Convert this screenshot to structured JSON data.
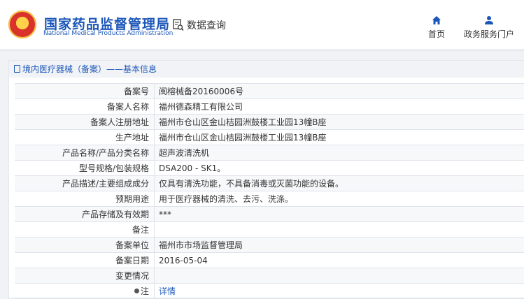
{
  "header": {
    "logo_cn": "国家药品监督管理局",
    "logo_en": "National Medical Products Administration",
    "query_label": "数据查询",
    "nav": [
      {
        "label": "首页",
        "icon": "home-icon"
      },
      {
        "label": "政务服务门户",
        "icon": "user-icon"
      }
    ],
    "brand_color": "#1b56b8"
  },
  "card": {
    "title": "境内医疗器械（备案）——基本信息"
  },
  "rows": [
    {
      "label": "备案号",
      "value": "闽榕械备20160006号"
    },
    {
      "label": "备案人名称",
      "value": "福州德森精工有限公司"
    },
    {
      "label": "备案人注册地址",
      "value": "福州市仓山区金山桔园洲鼓楼工业园13幢B座"
    },
    {
      "label": "生产地址",
      "value": "福州市仓山区金山桔园洲鼓楼工业园13幢B座"
    },
    {
      "label": "产品名称/产品分类名称",
      "value": "超声波清洗机"
    },
    {
      "label": "型号规格/包装规格",
      "value": "DSA200 - SK1。"
    },
    {
      "label": "产品描述/主要组成成分",
      "value": "仅具有清洗功能，不具备消毒或灭菌功能的设备。"
    },
    {
      "label": "预期用途",
      "value": "用于医疗器械的清洗、去污、洗涤。"
    },
    {
      "label": "产品存储及有效期",
      "value": "***"
    },
    {
      "label": "备注",
      "value": ""
    },
    {
      "label": "备案单位",
      "value": "福州市市场监督管理局"
    },
    {
      "label": "备案日期",
      "value": "2016-05-04"
    },
    {
      "label": "变更情况",
      "value": ""
    }
  ],
  "note_row": {
    "label": "注",
    "link": "详情"
  }
}
